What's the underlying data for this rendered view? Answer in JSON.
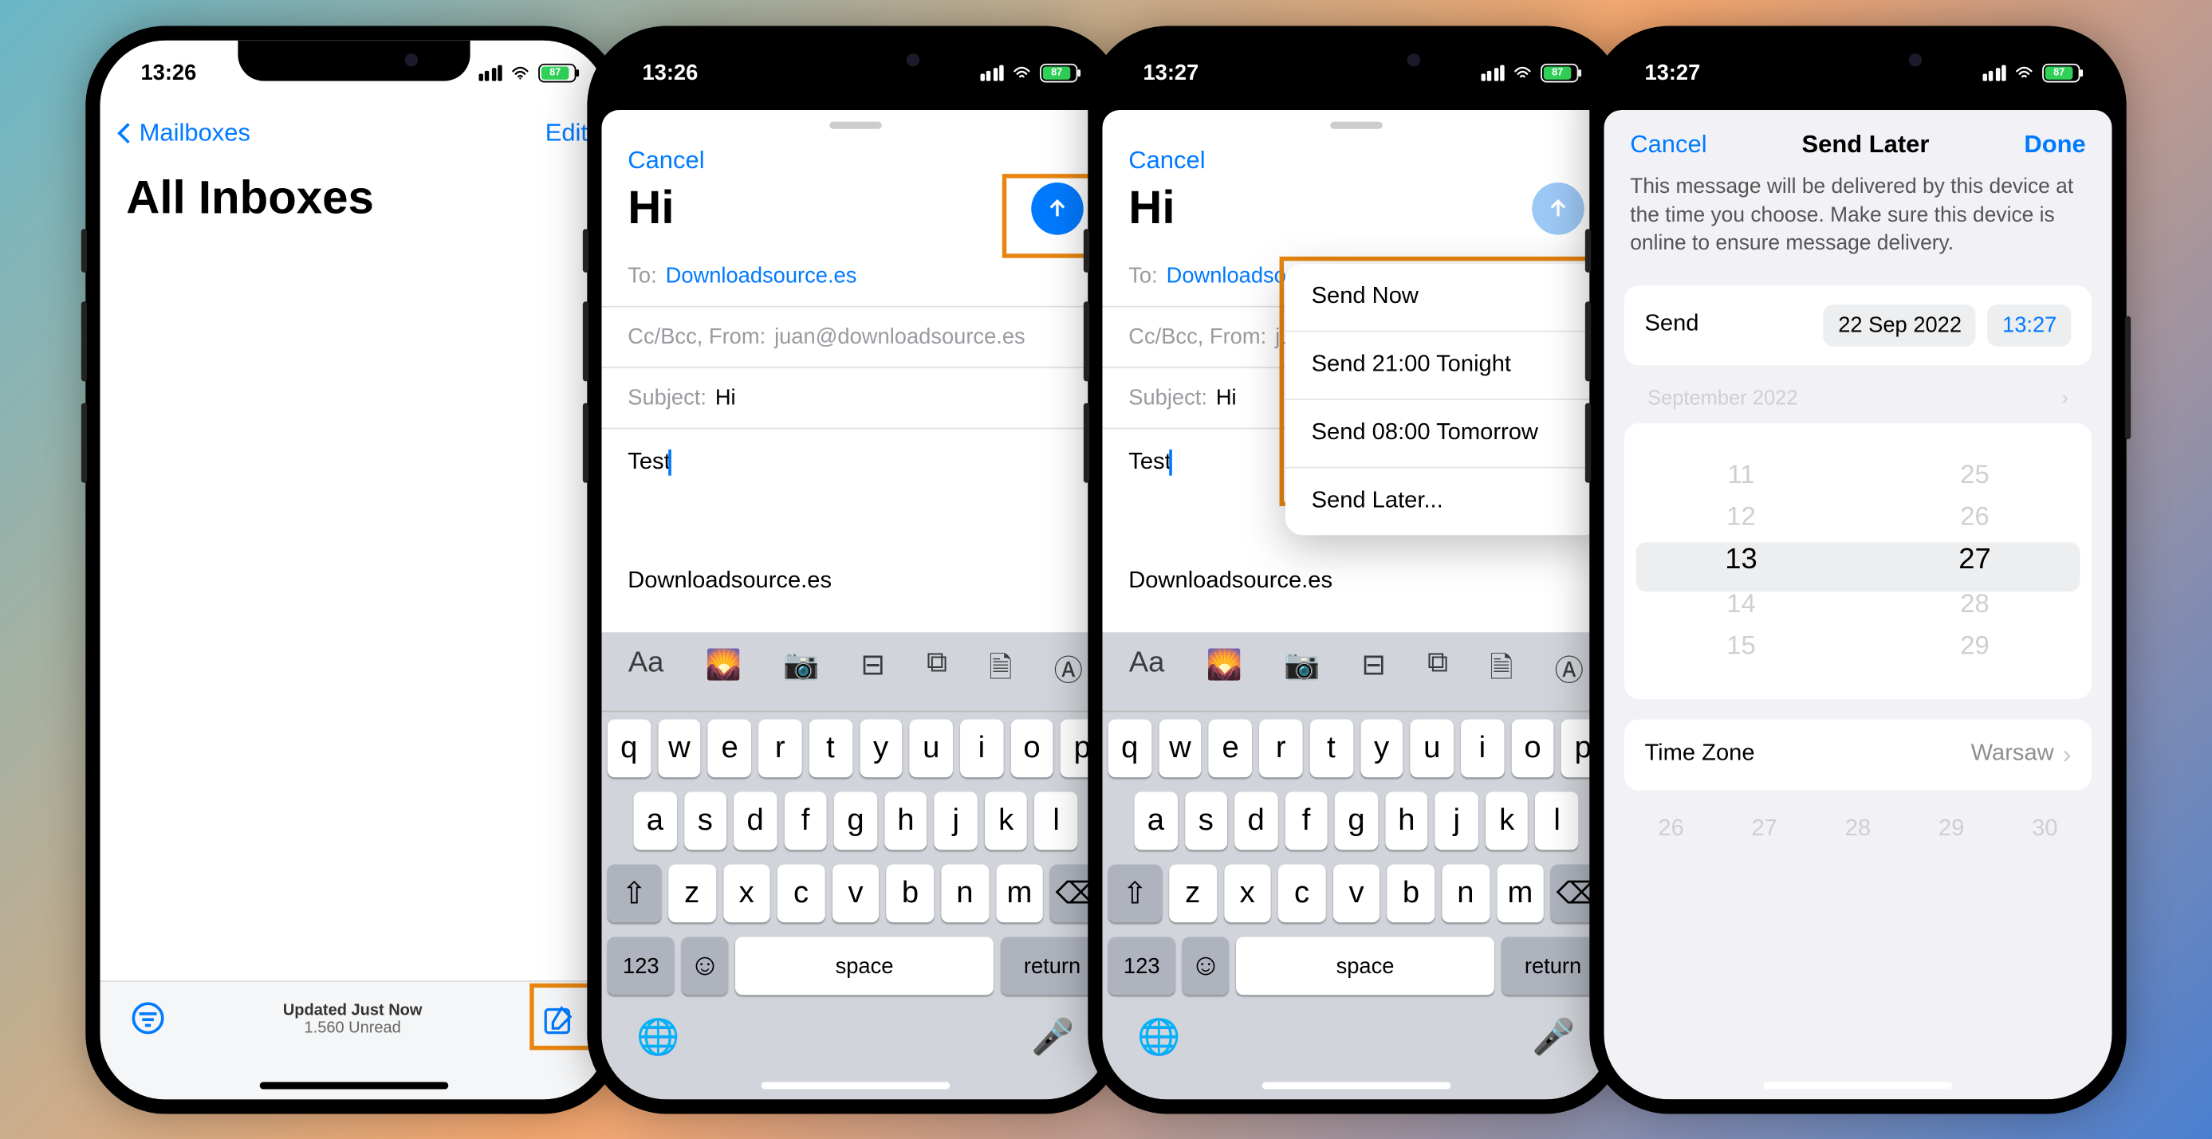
{
  "screen1": {
    "time": "13:26",
    "battery": "87",
    "back_label": "Mailboxes",
    "edit_label": "Edit",
    "title": "All Inboxes",
    "updated_label": "Updated Just Now",
    "unread_label": "1.560 Unread"
  },
  "screen2": {
    "time": "13:26",
    "battery": "87",
    "cancel_label": "Cancel",
    "subject_title": "Hi",
    "to_label": "To:",
    "to_value": "Downloadsource.es",
    "cc_label": "Cc/Bcc, From:",
    "cc_value": "juan@downloadsource.es",
    "subject_label": "Subject:",
    "subject_value": "Hi",
    "body_text": "Test",
    "signature": "Downloadsource.es"
  },
  "screen3": {
    "time": "13:27",
    "battery": "87",
    "cancel_label": "Cancel",
    "subject_title": "Hi",
    "to_label": "To:",
    "to_value": "Downloadso",
    "cc_label": "Cc/Bcc, From:",
    "cc_value": "ju",
    "subject_label": "Subject:",
    "subject_value": "Hi",
    "body_text": "Test",
    "signature": "Downloadsource.es",
    "popup": {
      "send_now": "Send Now",
      "tonight": "Send 21:00 Tonight",
      "tomorrow": "Send 08:00 Tomorrow",
      "later": "Send Later..."
    }
  },
  "screen4": {
    "time": "13:27",
    "battery": "87",
    "cancel_label": "Cancel",
    "title": "Send Later",
    "done_label": "Done",
    "info_text": "This message will be delivered by this device at the time you choose. Make sure this device is online to ensure message delivery.",
    "send_label": "Send",
    "date_chip": "22 Sep 2022",
    "time_chip": "13:27",
    "month_label": "September 2022",
    "wheel_hours": [
      "11",
      "12",
      "13",
      "14",
      "15"
    ],
    "wheel_mins": [
      "25",
      "26",
      "27",
      "28",
      "29"
    ],
    "tz_label": "Time Zone",
    "tz_value": "Warsaw",
    "ghost_row": [
      "26",
      "27",
      "28",
      "29",
      "30"
    ]
  },
  "keyboard": {
    "space": "space",
    "return": "return",
    "num": "123",
    "row1": [
      "q",
      "w",
      "e",
      "r",
      "t",
      "y",
      "u",
      "i",
      "o",
      "p"
    ],
    "row2": [
      "a",
      "s",
      "d",
      "f",
      "g",
      "h",
      "j",
      "k",
      "l"
    ],
    "row3": [
      "z",
      "x",
      "c",
      "v",
      "b",
      "n",
      "m"
    ]
  }
}
